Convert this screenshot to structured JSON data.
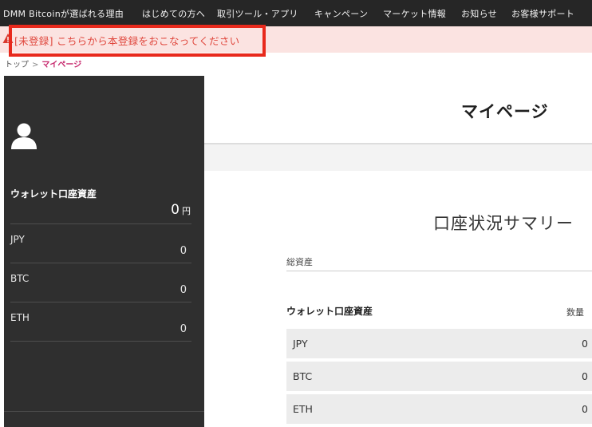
{
  "nav": {
    "items": [
      "DMM Bitcoinが選ばれる理由",
      "はじめての方へ",
      "取引ツール・アプリ",
      "キャンペーン",
      "マーケット情報",
      "お知らせ",
      "お客様サポート"
    ]
  },
  "alert": {
    "message": "[未登録] こちらから本登録をおこなってください",
    "color": "#e0483e",
    "highlight_color": "#e8291c"
  },
  "breadcrumb": {
    "home": "トップ",
    "separator": ">",
    "current": "マイページ"
  },
  "sidebar": {
    "icon": "user-avatar-icon",
    "title": "ウォレット口座資産",
    "total_value": "0",
    "total_unit": "円",
    "assets": [
      {
        "label": "JPY",
        "value": "0"
      },
      {
        "label": "BTC",
        "value": "0"
      },
      {
        "label": "ETH",
        "value": "0"
      }
    ]
  },
  "main": {
    "page_title": "マイページ",
    "summary_title": "口座状況サマリー",
    "total_assets_label": "総資産",
    "wallet_label": "ウォレット口座資産",
    "quantity_header": "数量",
    "rows": [
      {
        "label": "JPY",
        "value": "0"
      },
      {
        "label": "BTC",
        "value": "0"
      },
      {
        "label": "ETH",
        "value": "0"
      }
    ]
  }
}
